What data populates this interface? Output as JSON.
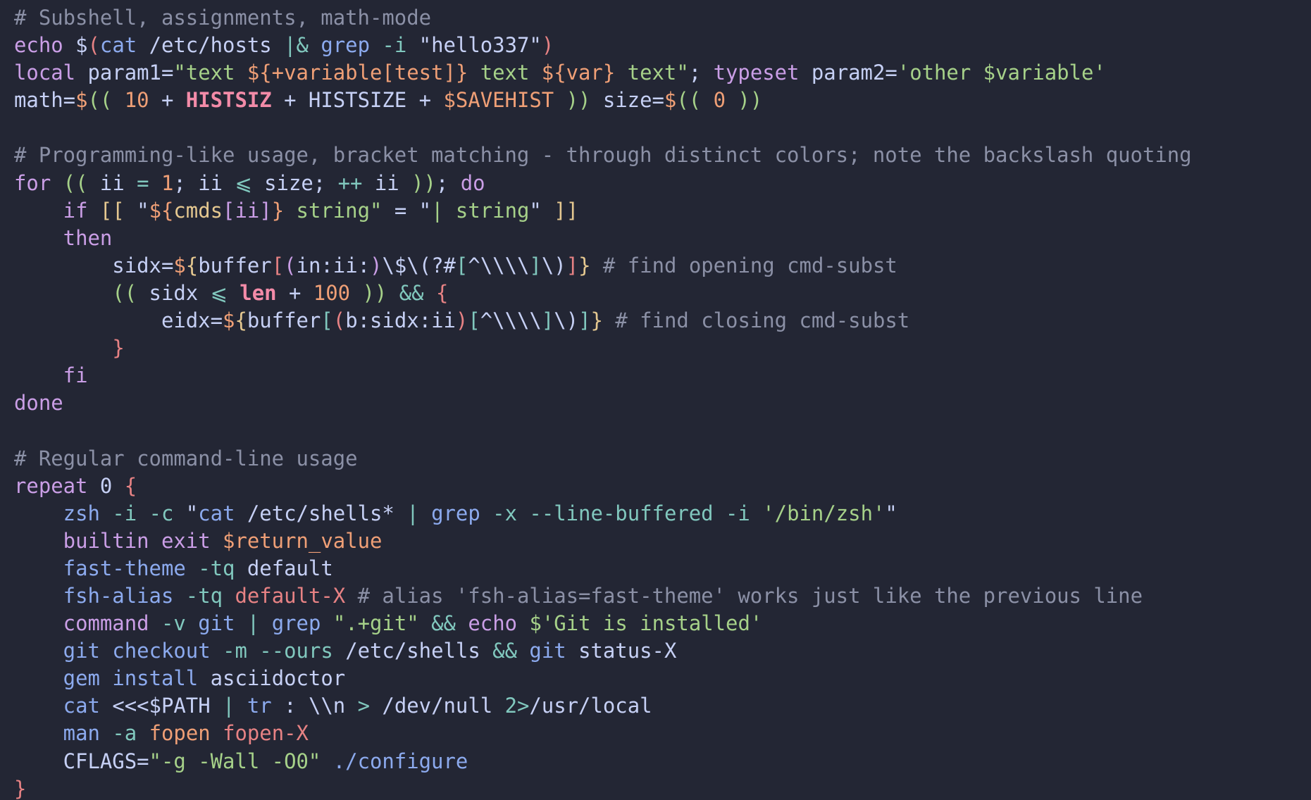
{
  "lines": [
    [
      [
        "c-comment",
        "# Subshell, assignments, math-mode"
      ]
    ],
    [
      [
        "c-builtin",
        "echo"
      ],
      [
        "c-text",
        " $"
      ],
      [
        "c-red",
        "("
      ],
      [
        "c-cmd",
        "cat"
      ],
      [
        "c-text",
        " /etc/hosts "
      ],
      [
        "c-op",
        "|&"
      ],
      [
        "c-text",
        " "
      ],
      [
        "c-cmd",
        "grep"
      ],
      [
        "c-text",
        " "
      ],
      [
        "c-op",
        "-i"
      ],
      [
        "c-text",
        " \"hello337\""
      ],
      [
        "c-red",
        ")"
      ]
    ],
    [
      [
        "c-builtin",
        "local"
      ],
      [
        "c-text",
        " param1="
      ],
      [
        "c-string",
        "\"text "
      ],
      [
        "c-number",
        "${+variable[test]}"
      ],
      [
        "c-string",
        " text "
      ],
      [
        "c-number",
        "${var}"
      ],
      [
        "c-string",
        " text\""
      ],
      [
        "c-text",
        "; "
      ],
      [
        "c-builtin",
        "typeset"
      ],
      [
        "c-text",
        " param2="
      ],
      [
        "c-string",
        "'other $variable'"
      ]
    ],
    [
      [
        "c-text",
        "math="
      ],
      [
        "c-number",
        "$"
      ],
      [
        "c-string",
        "(("
      ],
      [
        "c-number",
        " 10 "
      ],
      [
        "c-text",
        "+ "
      ],
      [
        "c-bold",
        "HISTSIZ"
      ],
      [
        "c-text",
        " + HISTSIZE + "
      ],
      [
        "c-number",
        "$SAVEHIST"
      ],
      [
        "c-string",
        " ))"
      ],
      [
        "c-text",
        " size="
      ],
      [
        "c-number",
        "$"
      ],
      [
        "c-string",
        "(("
      ],
      [
        "c-number",
        " 0 "
      ],
      [
        "c-string",
        "))"
      ]
    ],
    [],
    [
      [
        "c-comment",
        "# Programming-like usage, bracket matching - through distinct colors; note the backslash quoting"
      ]
    ],
    [
      [
        "c-keyword",
        "for"
      ],
      [
        "c-text",
        " "
      ],
      [
        "c-string",
        "(("
      ],
      [
        "c-text",
        " ii "
      ],
      [
        "c-op",
        "="
      ],
      [
        "c-text",
        " "
      ],
      [
        "c-number",
        "1"
      ],
      [
        "c-text",
        "; ii "
      ],
      [
        "c-op",
        "⩽"
      ],
      [
        "c-text",
        " size; "
      ],
      [
        "c-op",
        "++"
      ],
      [
        "c-text",
        " ii "
      ],
      [
        "c-string",
        "))"
      ],
      [
        "c-text",
        "; "
      ],
      [
        "c-keyword",
        "do"
      ]
    ],
    [
      [
        "c-text",
        "    "
      ],
      [
        "c-keyword",
        "if"
      ],
      [
        "c-text",
        " "
      ],
      [
        "c-yellow",
        "[["
      ],
      [
        "c-text",
        " \""
      ],
      [
        "c-number",
        "${"
      ],
      [
        "c-yellow",
        "cmds"
      ],
      [
        "c-bpurple",
        "[ii]"
      ],
      [
        "c-number",
        "}"
      ],
      [
        "c-string",
        " string\""
      ],
      [
        "c-text",
        " = \""
      ],
      [
        "c-string",
        "| string"
      ],
      [
        "c-text",
        "\" "
      ],
      [
        "c-yellow",
        "]]"
      ]
    ],
    [
      [
        "c-text",
        "    "
      ],
      [
        "c-keyword",
        "then"
      ]
    ],
    [
      [
        "c-text",
        "        sidx="
      ],
      [
        "c-number",
        "$"
      ],
      [
        "c-yellow",
        "{"
      ],
      [
        "c-text",
        "buffer"
      ],
      [
        "c-red",
        "["
      ],
      [
        "c-bpurple",
        "("
      ],
      [
        "c-text",
        "in:ii:"
      ],
      [
        "c-bpurple",
        ")"
      ],
      [
        "c-text",
        "\\$\\(?#"
      ],
      [
        "c-op",
        "["
      ],
      [
        "c-text",
        "^\\\\\\\\"
      ],
      [
        "c-op",
        "]"
      ],
      [
        "c-text",
        "\\)"
      ],
      [
        "c-red",
        "]"
      ],
      [
        "c-yellow",
        "}"
      ],
      [
        "c-comment",
        " # find opening cmd-subst"
      ]
    ],
    [
      [
        "c-text",
        "        "
      ],
      [
        "c-string",
        "(("
      ],
      [
        "c-text",
        " sidx "
      ],
      [
        "c-op",
        "⩽"
      ],
      [
        "c-text",
        " "
      ],
      [
        "c-bold",
        "len"
      ],
      [
        "c-text",
        " + "
      ],
      [
        "c-number",
        "100"
      ],
      [
        "c-text",
        " "
      ],
      [
        "c-string",
        "))"
      ],
      [
        "c-text",
        " "
      ],
      [
        "c-op",
        "&&"
      ],
      [
        "c-text",
        " "
      ],
      [
        "c-red",
        "{"
      ]
    ],
    [
      [
        "c-text",
        "            eidx="
      ],
      [
        "c-number",
        "$"
      ],
      [
        "c-yellow",
        "{"
      ],
      [
        "c-text",
        "buffer"
      ],
      [
        "c-op",
        "["
      ],
      [
        "c-red",
        "("
      ],
      [
        "c-text",
        "b:sidx:ii"
      ],
      [
        "c-red",
        ")"
      ],
      [
        "c-op",
        "["
      ],
      [
        "c-text",
        "^\\\\\\\\"
      ],
      [
        "c-op",
        "]"
      ],
      [
        "c-text",
        "\\)"
      ],
      [
        "c-op",
        "]"
      ],
      [
        "c-yellow",
        "}"
      ],
      [
        "c-comment",
        " # find closing cmd-subst"
      ]
    ],
    [
      [
        "c-text",
        "        "
      ],
      [
        "c-red",
        "}"
      ]
    ],
    [
      [
        "c-text",
        "    "
      ],
      [
        "c-keyword",
        "fi"
      ]
    ],
    [
      [
        "c-keyword",
        "done"
      ]
    ],
    [],
    [
      [
        "c-comment",
        "# Regular command-line usage"
      ]
    ],
    [
      [
        "c-builtin",
        "repeat"
      ],
      [
        "c-text",
        " "
      ],
      [
        "c-text",
        "0 "
      ],
      [
        "c-red",
        "{"
      ]
    ],
    [
      [
        "c-text",
        "    "
      ],
      [
        "c-cmd",
        "zsh"
      ],
      [
        "c-text",
        " "
      ],
      [
        "c-op",
        "-i -c"
      ],
      [
        "c-text",
        " \""
      ],
      [
        "c-cmd",
        "cat"
      ],
      [
        "c-text",
        " /etc/shells* "
      ],
      [
        "c-op",
        "|"
      ],
      [
        "c-text",
        " "
      ],
      [
        "c-cmd",
        "grep"
      ],
      [
        "c-text",
        " "
      ],
      [
        "c-op",
        "-x --line-buffered -i"
      ],
      [
        "c-text",
        " "
      ],
      [
        "c-string",
        "'/bin/zsh'"
      ],
      [
        "c-text",
        "\""
      ]
    ],
    [
      [
        "c-text",
        "    "
      ],
      [
        "c-builtin",
        "builtin exit"
      ],
      [
        "c-text",
        " "
      ],
      [
        "c-number",
        "$return_value"
      ]
    ],
    [
      [
        "c-text",
        "    "
      ],
      [
        "c-cmd",
        "fast-theme"
      ],
      [
        "c-text",
        " "
      ],
      [
        "c-op",
        "-tq"
      ],
      [
        "c-text",
        " default"
      ]
    ],
    [
      [
        "c-text",
        "    "
      ],
      [
        "c-cmd",
        "fsh-alias"
      ],
      [
        "c-text",
        " "
      ],
      [
        "c-op",
        "-tq"
      ],
      [
        "c-text",
        " "
      ],
      [
        "c-red",
        "default-X"
      ],
      [
        "c-comment",
        " # alias 'fsh-alias=fast-theme' works just like the previous line"
      ]
    ],
    [
      [
        "c-text",
        "    "
      ],
      [
        "c-builtin",
        "command"
      ],
      [
        "c-text",
        " "
      ],
      [
        "c-op",
        "-v"
      ],
      [
        "c-text",
        " "
      ],
      [
        "c-cmd",
        "git"
      ],
      [
        "c-text",
        " "
      ],
      [
        "c-op",
        "|"
      ],
      [
        "c-text",
        " "
      ],
      [
        "c-cmd",
        "grep"
      ],
      [
        "c-text",
        " "
      ],
      [
        "c-string",
        "\".+git\""
      ],
      [
        "c-text",
        " "
      ],
      [
        "c-op",
        "&&"
      ],
      [
        "c-text",
        " "
      ],
      [
        "c-builtin",
        "echo"
      ],
      [
        "c-text",
        " "
      ],
      [
        "c-string",
        "$'Git is installed'"
      ]
    ],
    [
      [
        "c-text",
        "    "
      ],
      [
        "c-cmd",
        "git"
      ],
      [
        "c-text",
        " "
      ],
      [
        "c-cmd",
        "checkout"
      ],
      [
        "c-text",
        " "
      ],
      [
        "c-op",
        "-m --ours"
      ],
      [
        "c-text",
        " /etc/shells "
      ],
      [
        "c-op",
        "&&"
      ],
      [
        "c-text",
        " "
      ],
      [
        "c-cmd",
        "git"
      ],
      [
        "c-text",
        " status-X"
      ]
    ],
    [
      [
        "c-text",
        "    "
      ],
      [
        "c-cmd",
        "gem"
      ],
      [
        "c-text",
        " "
      ],
      [
        "c-cmd",
        "install"
      ],
      [
        "c-text",
        " asciidoctor"
      ]
    ],
    [
      [
        "c-text",
        "    "
      ],
      [
        "c-cmd",
        "cat"
      ],
      [
        "c-text",
        " <<<$PATH "
      ],
      [
        "c-op",
        "|"
      ],
      [
        "c-text",
        " "
      ],
      [
        "c-cmd",
        "tr"
      ],
      [
        "c-text",
        " : \\\\n "
      ],
      [
        "c-op",
        ">"
      ],
      [
        "c-text",
        " /dev/null "
      ],
      [
        "c-op",
        "2>"
      ],
      [
        "c-text",
        "/usr/local"
      ]
    ],
    [
      [
        "c-text",
        "    "
      ],
      [
        "c-cmd",
        "man"
      ],
      [
        "c-text",
        " "
      ],
      [
        "c-op",
        "-a"
      ],
      [
        "c-text",
        " "
      ],
      [
        "c-number",
        "fopen"
      ],
      [
        "c-text",
        " "
      ],
      [
        "c-red",
        "fopen-X"
      ]
    ],
    [
      [
        "c-text",
        "    CFLAGS="
      ],
      [
        "c-string",
        "\"-g -Wall -O0\""
      ],
      [
        "c-text",
        " "
      ],
      [
        "c-cmd",
        "./configure"
      ]
    ],
    [
      [
        "c-red",
        "}"
      ]
    ]
  ]
}
